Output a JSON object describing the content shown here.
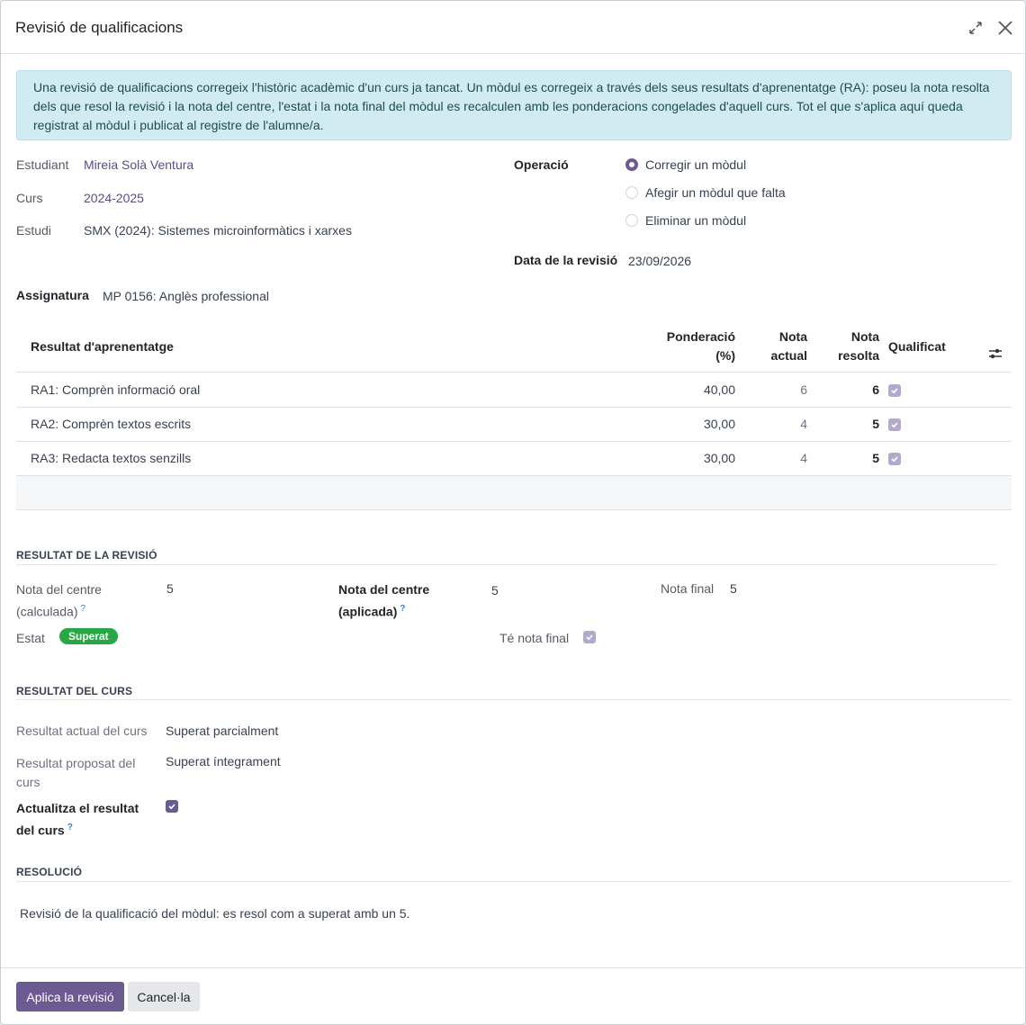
{
  "dialog": {
    "title": "Revisió de qualificacions",
    "alert": "Una revisió de qualificacions corregeix l'històric acadèmic d'un curs ja tancat. Un mòdul es corregeix a través dels seus resultats d'aprenentatge (RA): poseu la nota resolta dels que resol la revisió i la nota del centre, l'estat i la nota final del mòdul es recalculen amb les ponderacions congelades d'aquell curs. Tot el que s'aplica aquí queda registrat al mòdul i publicat al registre de l'alumne/a."
  },
  "fields": {
    "student_label": "Estudiant",
    "student_value": "Mireia Solà Ventura",
    "course_label": "Curs",
    "course_value": "2024-2025",
    "study_label": "Estudi",
    "study_value": "SMX (2024): Sistemes microinformàtics i xarxes",
    "operation_label": "Operació",
    "operation_options": [
      "Corregir un mòdul",
      "Afegir un mòdul que falta",
      "Eliminar un mòdul"
    ],
    "operation_selected": 0,
    "date_label": "Data de la revisió",
    "date_value": "23/09/2026",
    "subject_label": "Assignatura",
    "subject_value": "MP 0156: Anglès professional"
  },
  "table": {
    "headers": {
      "outcome": "Resultat d'aprenentatge",
      "weight_1": "Ponderació",
      "weight_2": "(%)",
      "current_1": "Nota",
      "current_2": "actual",
      "resolved_1": "Nota",
      "resolved_2": "resolta",
      "graded": "Qualificat"
    },
    "rows": [
      {
        "outcome": "RA1: Comprèn informació oral",
        "weight": "40,00",
        "current": "6",
        "resolved": "6",
        "graded": true
      },
      {
        "outcome": "RA2: Comprèn textos escrits",
        "weight": "30,00",
        "current": "4",
        "resolved": "5",
        "graded": true
      },
      {
        "outcome": "RA3: Redacta textos senzills",
        "weight": "30,00",
        "current": "4",
        "resolved": "5",
        "graded": true
      }
    ]
  },
  "review_result": {
    "title": "RESULTAT DE LA REVISIÓ",
    "center_calc_label_1": "Nota del centre",
    "center_calc_label_2": "(calculada)",
    "center_calc_value": "5",
    "center_applied_label_1": "Nota del centre",
    "center_applied_label_2": "(aplicada)",
    "center_applied_value": "5",
    "final_label": "Nota final",
    "final_value": "5",
    "status_label": "Estat",
    "status_value": "Superat",
    "has_final_label": "Té nota final",
    "help_mark": "?"
  },
  "course_result": {
    "title": "RESULTAT DEL CURS",
    "current_label": "Resultat actual del curs",
    "current_value": "Superat parcialment",
    "proposed_label_1": "Resultat proposat del",
    "proposed_label_2": "curs",
    "proposed_value": "Superat íntegrament",
    "update_label_1": "Actualitza el resultat",
    "update_label_2": "del curs"
  },
  "resolution": {
    "title": "RESOLUCIÓ",
    "text": "Revisió de la qualificació del mòdul: es resol com a superat amb un 5."
  },
  "footer": {
    "apply_label": "Aplica la revisió",
    "cancel_label": "Cancel·la"
  },
  "colors": {
    "primary": "#6c5a93",
    "success": "#28a745",
    "alert_bg": "#d0ecf0"
  }
}
